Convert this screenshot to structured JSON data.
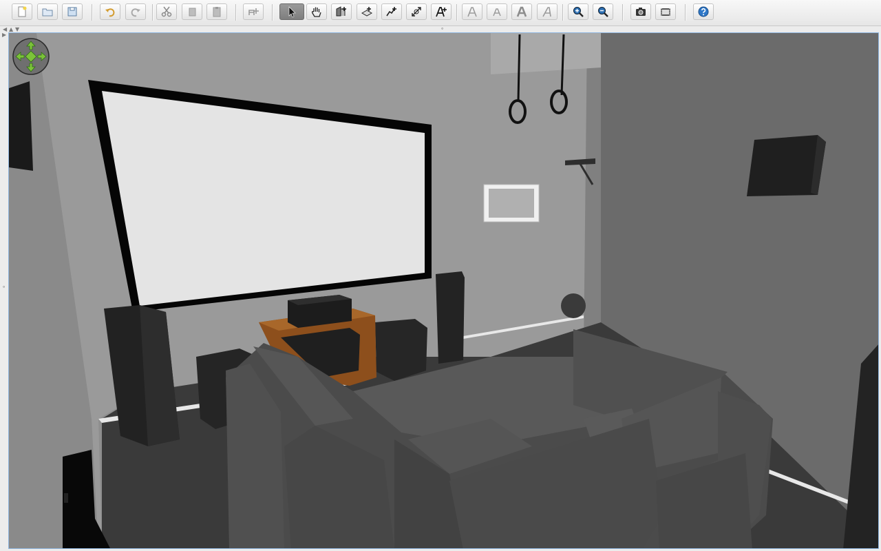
{
  "toolbar": {
    "buttons": [
      {
        "icon": "new-document-icon"
      },
      {
        "icon": "open-folder-icon"
      },
      {
        "icon": "save-icon"
      },
      {
        "icon": "undo-icon"
      },
      {
        "icon": "redo-icon"
      },
      {
        "icon": "cut-icon"
      },
      {
        "icon": "copy-icon"
      },
      {
        "icon": "paste-icon"
      },
      {
        "icon": "add-furniture-icon"
      },
      {
        "icon": "select-arrow-icon",
        "selected": true
      },
      {
        "icon": "pan-hand-icon"
      },
      {
        "icon": "create-walls-icon"
      },
      {
        "icon": "create-rooms-icon"
      },
      {
        "icon": "create-polylines-icon"
      },
      {
        "icon": "create-dimensions-icon"
      },
      {
        "icon": "add-text-icon"
      },
      {
        "icon": "increase-text-size-icon"
      },
      {
        "icon": "decrease-text-size-icon"
      },
      {
        "icon": "bold-text-icon"
      },
      {
        "icon": "italic-text-icon"
      },
      {
        "icon": "zoom-in-icon"
      },
      {
        "icon": "zoom-out-icon"
      },
      {
        "icon": "create-photo-icon"
      },
      {
        "icon": "create-video-icon"
      },
      {
        "icon": "help-icon"
      }
    ]
  },
  "view3d": {
    "navigation_widget": "navigation-arrows-icon",
    "colors": {
      "accent_green": "#7cc23a",
      "screen_white": "#e4e4e4",
      "wood": "#9a5a22",
      "sofa": "#4b4b4b"
    }
  }
}
